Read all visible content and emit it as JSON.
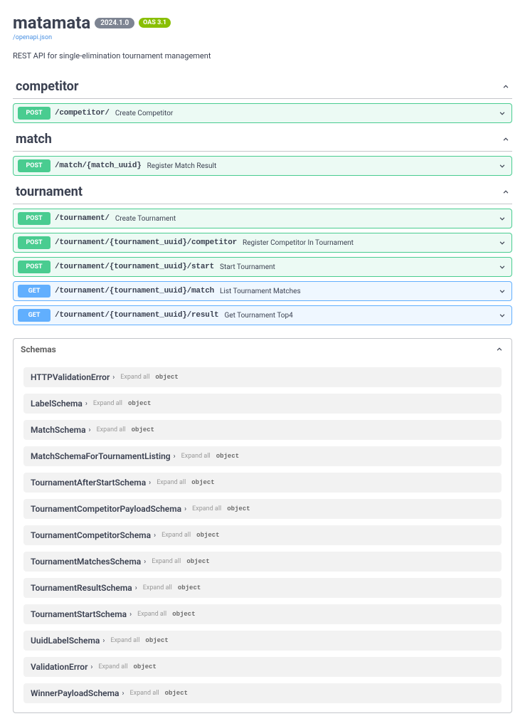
{
  "header": {
    "title": "matamata",
    "version": "2024.1.0",
    "oas": "OAS 3.1",
    "spec_link": "/openapi.json",
    "description": "REST API for single-elimination tournament management"
  },
  "tags": [
    {
      "name": "competitor",
      "ops": [
        {
          "method": "POST",
          "path": "/competitor/",
          "summary": "Create Competitor"
        }
      ]
    },
    {
      "name": "match",
      "ops": [
        {
          "method": "POST",
          "path": "/match/{match_uuid}",
          "summary": "Register Match Result"
        }
      ]
    },
    {
      "name": "tournament",
      "ops": [
        {
          "method": "POST",
          "path": "/tournament/",
          "summary": "Create Tournament"
        },
        {
          "method": "POST",
          "path": "/tournament/{tournament_uuid}/competitor",
          "summary": "Register Competitor In Tournament"
        },
        {
          "method": "POST",
          "path": "/tournament/{tournament_uuid}/start",
          "summary": "Start Tournament"
        },
        {
          "method": "GET",
          "path": "/tournament/{tournament_uuid}/match",
          "summary": "List Tournament Matches"
        },
        {
          "method": "GET",
          "path": "/tournament/{tournament_uuid}/result",
          "summary": "Get Tournament Top4"
        }
      ]
    }
  ],
  "schemas": {
    "header": "Schemas",
    "expand_label": "Expand all",
    "type_label": "object",
    "items": [
      "HTTPValidationError",
      "LabelSchema",
      "MatchSchema",
      "MatchSchemaForTournamentListing",
      "TournamentAfterStartSchema",
      "TournamentCompetitorPayloadSchema",
      "TournamentCompetitorSchema",
      "TournamentMatchesSchema",
      "TournamentResultSchema",
      "TournamentStartSchema",
      "UuidLabelSchema",
      "ValidationError",
      "WinnerPayloadSchema"
    ]
  }
}
